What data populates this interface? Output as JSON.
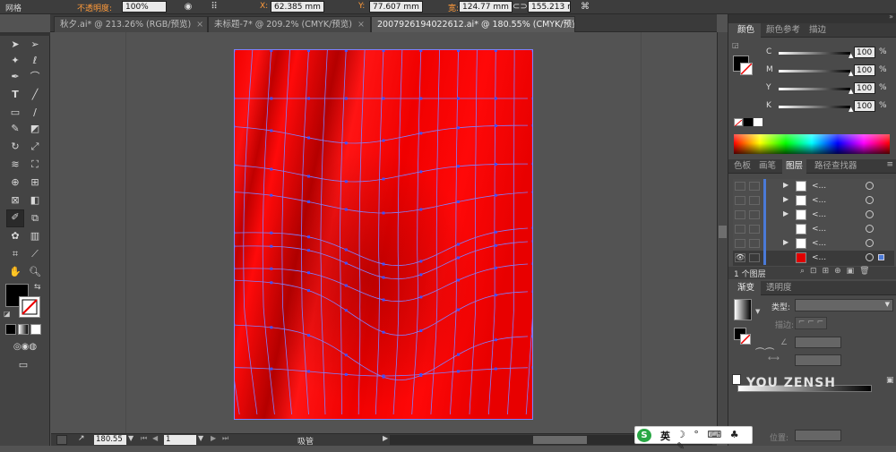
{
  "control_bar": {
    "mode_label": "网格",
    "opacity_label": "不透明度:",
    "opacity_value": "100%",
    "x_label": "X:",
    "x_value": "62.385 mm",
    "y_label": "Y:",
    "y_value": "77.607 mm",
    "w_label": "宽:",
    "w_value": "124.77 mm",
    "h_value": "155.213 m"
  },
  "tabs": [
    {
      "label": "秋夕.ai* @ 213.26% (RGB/预览)",
      "close": "×"
    },
    {
      "label": "未标题-7* @ 209.2% (CMYK/预览)",
      "close": "×"
    },
    {
      "label": "2007926194022612.ai* @ 180.55% (CMYK/预览)",
      "close": "×"
    }
  ],
  "color_panel": {
    "tabs": [
      "颜色",
      "颜色参考",
      "描边"
    ],
    "channels": [
      {
        "name": "C",
        "value": "100"
      },
      {
        "name": "M",
        "value": "100"
      },
      {
        "name": "Y",
        "value": "100"
      },
      {
        "name": "K",
        "value": "100"
      }
    ]
  },
  "layers_panel": {
    "tabs": [
      "色板",
      "画笔",
      "图层",
      "路径查找器"
    ],
    "rows": [
      "<...",
      "<...",
      "<...",
      "<...",
      "<...",
      "<..."
    ],
    "footer_count": "1 个图层"
  },
  "gradient_panel": {
    "tabs": [
      "渐变",
      "透明度"
    ],
    "type_label": "类型:",
    "stroke_label": "描边:",
    "position_label": "位置:"
  },
  "status_bar": {
    "zoom": "180.55",
    "page": "1",
    "tool": "吸管"
  },
  "ime": {
    "lang": "英",
    "icons": "☽ ° ⌨ ♣ ✎"
  },
  "watermark": "YOU ZENSH",
  "colors": {
    "fill": "#ee0000",
    "mesh_line": "#8080ff",
    "mesh_point": "#4050ff",
    "ui_dark": "#3a3a3a",
    "ui_mid": "#535353"
  }
}
